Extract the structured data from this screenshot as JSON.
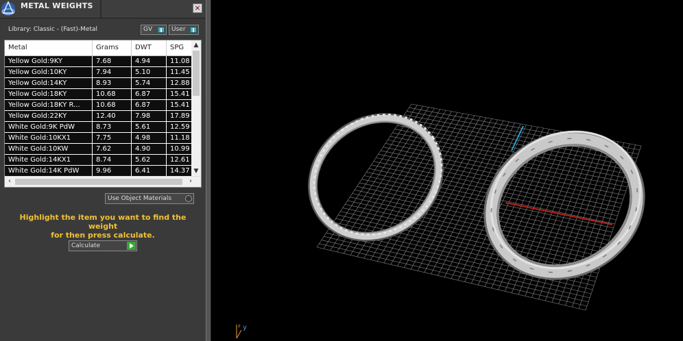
{
  "panel": {
    "title": "METAL WEIGHTS",
    "close_label": "×",
    "library": "Library: Classic - (Fast)-Metal",
    "toggles": {
      "gv": "GV",
      "user": "User"
    },
    "use_object_materials": "Use Object Materials",
    "instruction_line1": "Highlight the item you want to find the weight",
    "instruction_line2": "for then press calculate.",
    "calculate_label": "Calculate"
  },
  "table": {
    "columns": [
      "Metal",
      "Grams",
      "DWT",
      "SPG"
    ],
    "rows": [
      [
        "Yellow Gold:9KY",
        "7.68",
        "4.94",
        "11.08"
      ],
      [
        "Yellow Gold:10KY",
        "7.94",
        "5.10",
        "11.45"
      ],
      [
        "Yellow Gold:14KY",
        "8.93",
        "5.74",
        "12.88"
      ],
      [
        "Yellow Gold:18KY",
        "10.68",
        "6.87",
        "15.41"
      ],
      [
        "Yellow Gold:18KY R...",
        "10.68",
        "6.87",
        "15.41"
      ],
      [
        "Yellow Gold:22KY",
        "12.40",
        "7.98",
        "17.89"
      ],
      [
        "White Gold:9K PdW",
        "8.73",
        "5.61",
        "12.59"
      ],
      [
        "White Gold:10KX1",
        "7.75",
        "4.98",
        "11.18"
      ],
      [
        "White Gold:10KW",
        "7.62",
        "4.90",
        "10.99"
      ],
      [
        "White Gold:14KX1",
        "8.74",
        "5.62",
        "12.61"
      ],
      [
        "White Gold:14K PdW",
        "9.96",
        "6.41",
        "14.37"
      ]
    ]
  },
  "viewport": {
    "axis_label": "y",
    "colors": {
      "background": "#000000",
      "grid": "#8a8a8a",
      "x_axis": "#c0201a",
      "y_axis": "#2aa0d0",
      "ring": "#c9c9c9"
    }
  },
  "icons": [
    "app-logo-icon",
    "close-icon",
    "toggle-knob-icon",
    "scroll-up-icon",
    "scroll-down-icon",
    "scroll-left-icon",
    "scroll-right-icon",
    "radio-icon",
    "play-arrow-icon",
    "axis-gizmo-icon"
  ]
}
